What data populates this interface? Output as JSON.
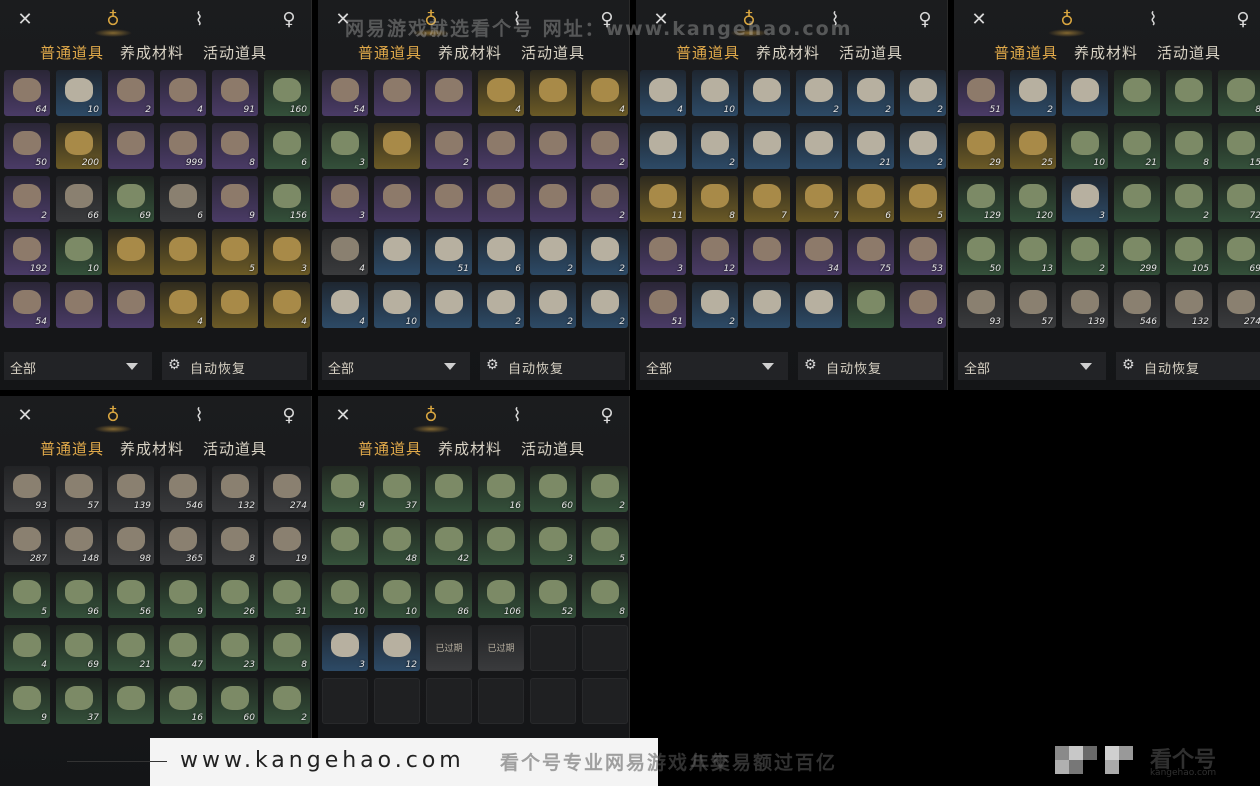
{
  "tabs": {
    "icons": [
      "swords-icon",
      "pouch-icon",
      "scroll-icon",
      "gourd-icon"
    ]
  },
  "categories": {
    "common": "普通道具",
    "materials": "养成材料",
    "events": "活动道具"
  },
  "filter": {
    "label": "全部"
  },
  "auto_restore": {
    "label": "自动恢复"
  },
  "panels": [
    {
      "rows": [
        [
          [
            "purple",
            "64"
          ],
          [
            "blue",
            "10"
          ],
          [
            "purple",
            "2"
          ],
          [
            "purple",
            "4"
          ],
          [
            "purple",
            "91"
          ],
          [
            "green",
            "160"
          ]
        ],
        [
          [
            "purple",
            "50"
          ],
          [
            "gold",
            "200"
          ],
          [
            "purple",
            ""
          ],
          [
            "purple",
            "999"
          ],
          [
            "purple",
            "8"
          ],
          [
            "green",
            "6"
          ]
        ],
        [
          [
            "purple",
            "2"
          ],
          [
            "gray",
            "66"
          ],
          [
            "green",
            "69"
          ],
          [
            "gray",
            "6"
          ],
          [
            "purple",
            "9"
          ],
          [
            "green",
            "156"
          ]
        ],
        [
          [
            "purple",
            "192"
          ],
          [
            "green",
            "10"
          ],
          [
            "gold",
            ""
          ],
          [
            "gold",
            ""
          ],
          [
            "gold",
            "5"
          ],
          [
            "gold",
            "3"
          ]
        ],
        [
          [
            "purple",
            "54"
          ],
          [
            "purple",
            ""
          ],
          [
            "purple",
            ""
          ],
          [
            "gold",
            "4"
          ],
          [
            "gold",
            ""
          ],
          [
            "gold",
            "4"
          ]
        ]
      ]
    },
    {
      "rows": [
        [
          [
            "purple",
            "54"
          ],
          [
            "purple",
            ""
          ],
          [
            "purple",
            ""
          ],
          [
            "gold",
            "4"
          ],
          [
            "gold",
            ""
          ],
          [
            "gold",
            "4"
          ]
        ],
        [
          [
            "green",
            "3"
          ],
          [
            "gold",
            ""
          ],
          [
            "purple",
            "2"
          ],
          [
            "purple",
            ""
          ],
          [
            "purple",
            ""
          ],
          [
            "purple",
            "2"
          ]
        ],
        [
          [
            "purple",
            "3"
          ],
          [
            "purple",
            ""
          ],
          [
            "purple",
            ""
          ],
          [
            "purple",
            ""
          ],
          [
            "purple",
            ""
          ],
          [
            "purple",
            "2"
          ]
        ],
        [
          [
            "gray",
            "4"
          ],
          [
            "blue",
            ""
          ],
          [
            "blue",
            "51"
          ],
          [
            "blue",
            "6"
          ],
          [
            "blue",
            "2"
          ],
          [
            "blue",
            "2"
          ]
        ],
        [
          [
            "blue",
            "4"
          ],
          [
            "blue",
            "10"
          ],
          [
            "blue",
            ""
          ],
          [
            "blue",
            "2"
          ],
          [
            "blue",
            "2"
          ],
          [
            "blue",
            "2"
          ]
        ]
      ]
    },
    {
      "rows": [
        [
          [
            "blue",
            "4"
          ],
          [
            "blue",
            "10"
          ],
          [
            "blue",
            ""
          ],
          [
            "blue",
            "2"
          ],
          [
            "blue",
            "2"
          ],
          [
            "blue",
            "2"
          ]
        ],
        [
          [
            "blue",
            ""
          ],
          [
            "blue",
            "2"
          ],
          [
            "blue",
            ""
          ],
          [
            "blue",
            ""
          ],
          [
            "blue",
            "21"
          ],
          [
            "blue",
            "2"
          ]
        ],
        [
          [
            "gold",
            "11"
          ],
          [
            "gold",
            "8"
          ],
          [
            "gold",
            "7"
          ],
          [
            "gold",
            "7"
          ],
          [
            "gold",
            "6"
          ],
          [
            "gold",
            "5"
          ]
        ],
        [
          [
            "purple",
            "3"
          ],
          [
            "purple",
            "12"
          ],
          [
            "purple",
            ""
          ],
          [
            "purple",
            "34"
          ],
          [
            "purple",
            "75"
          ],
          [
            "purple",
            "53"
          ]
        ],
        [
          [
            "purple",
            "51"
          ],
          [
            "blue",
            "2"
          ],
          [
            "blue",
            ""
          ],
          [
            "blue",
            ""
          ],
          [
            "green",
            ""
          ],
          [
            "purple",
            "8"
          ]
        ]
      ]
    },
    {
      "rows": [
        [
          [
            "purple",
            "51"
          ],
          [
            "blue",
            "2"
          ],
          [
            "blue",
            ""
          ],
          [
            "green",
            ""
          ],
          [
            "green",
            ""
          ],
          [
            "green",
            "8"
          ]
        ],
        [
          [
            "gold",
            "29"
          ],
          [
            "gold",
            "25"
          ],
          [
            "green",
            "10"
          ],
          [
            "green",
            "21"
          ],
          [
            "green",
            "8"
          ],
          [
            "green",
            "15"
          ]
        ],
        [
          [
            "green",
            "129"
          ],
          [
            "green",
            "120"
          ],
          [
            "blue",
            "3"
          ],
          [
            "green",
            ""
          ],
          [
            "green",
            "2"
          ],
          [
            "green",
            "72"
          ]
        ],
        [
          [
            "green",
            "50"
          ],
          [
            "green",
            "13"
          ],
          [
            "green",
            "2"
          ],
          [
            "green",
            "299"
          ],
          [
            "green",
            "105"
          ],
          [
            "green",
            "69"
          ]
        ],
        [
          [
            "gray",
            "93"
          ],
          [
            "gray",
            "57"
          ],
          [
            "gray",
            "139"
          ],
          [
            "gray",
            "546"
          ],
          [
            "gray",
            "132"
          ],
          [
            "gray",
            "274"
          ]
        ]
      ]
    },
    {
      "rows": [
        [
          [
            "gray",
            "93"
          ],
          [
            "gray",
            "57"
          ],
          [
            "gray",
            "139"
          ],
          [
            "gray",
            "546"
          ],
          [
            "gray",
            "132"
          ],
          [
            "gray",
            "274"
          ]
        ],
        [
          [
            "gray",
            "287"
          ],
          [
            "gray",
            "148"
          ],
          [
            "gray",
            "98"
          ],
          [
            "gray",
            "365"
          ],
          [
            "gray",
            "8"
          ],
          [
            "gray",
            "19"
          ]
        ],
        [
          [
            "green",
            "5"
          ],
          [
            "green",
            "96"
          ],
          [
            "green",
            "56"
          ],
          [
            "green",
            "9"
          ],
          [
            "green",
            "26"
          ],
          [
            "green",
            "31"
          ]
        ],
        [
          [
            "green",
            "4"
          ],
          [
            "green",
            "69"
          ],
          [
            "green",
            "21"
          ],
          [
            "green",
            "47"
          ],
          [
            "green",
            "23"
          ],
          [
            "green",
            "8"
          ]
        ],
        [
          [
            "green",
            "9"
          ],
          [
            "green",
            "37"
          ],
          [
            "green",
            ""
          ],
          [
            "green",
            "16"
          ],
          [
            "green",
            "60"
          ],
          [
            "green",
            "2"
          ]
        ]
      ]
    },
    {
      "rows": [
        [
          [
            "green",
            "9"
          ],
          [
            "green",
            "37"
          ],
          [
            "green",
            ""
          ],
          [
            "green",
            "16"
          ],
          [
            "green",
            "60"
          ],
          [
            "green",
            "2"
          ]
        ],
        [
          [
            "green",
            ""
          ],
          [
            "green",
            "48"
          ],
          [
            "green",
            "42"
          ],
          [
            "green",
            ""
          ],
          [
            "green",
            "3"
          ],
          [
            "green",
            "5"
          ]
        ],
        [
          [
            "green",
            "10"
          ],
          [
            "green",
            "10"
          ],
          [
            "green",
            "86"
          ],
          [
            "green",
            "106"
          ],
          [
            "green",
            "52"
          ],
          [
            "green",
            "8"
          ]
        ],
        [
          [
            "blue",
            "3"
          ],
          [
            "blue",
            "12"
          ],
          [
            "expired",
            ""
          ],
          [
            "expired",
            ""
          ],
          [
            "empty",
            ""
          ],
          [
            "empty",
            ""
          ]
        ],
        [
          [
            "empty",
            ""
          ],
          [
            "empty",
            ""
          ],
          [
            "empty",
            ""
          ],
          [
            "empty",
            ""
          ],
          [
            "empty",
            ""
          ],
          [
            "empty",
            ""
          ]
        ]
      ]
    }
  ],
  "expired_label": "已过期",
  "watermark_top": "网易游戏就选看个号   网址：www.kangehao.com",
  "footer": {
    "url": "www.kangehao.com",
    "slogan": "看个号专业网易游戏八年",
    "slogan2": "年交易额过百亿",
    "logo_text": "看个号",
    "logo_sub": "kangehao.com"
  },
  "colors": {
    "accent": "#e0a94a",
    "panel": "#18191b"
  }
}
